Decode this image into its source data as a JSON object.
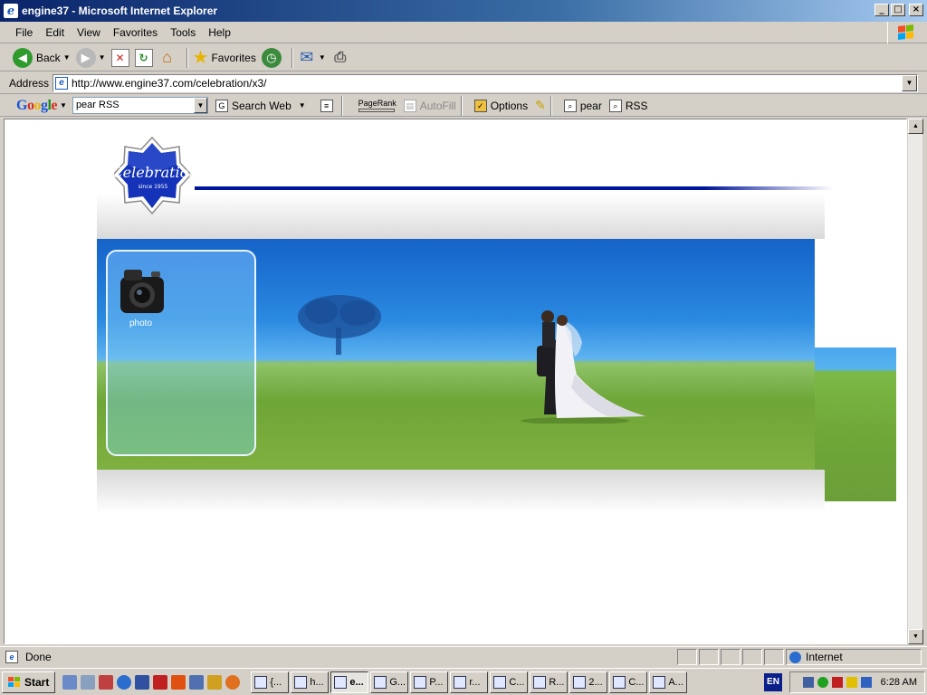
{
  "window": {
    "title": "engine37 - Microsoft Internet Explorer"
  },
  "menu": [
    "File",
    "Edit",
    "View",
    "Favorites",
    "Tools",
    "Help"
  ],
  "toolbar": {
    "back_label": "Back",
    "favorites_label": "Favorites"
  },
  "address": {
    "label": "Address",
    "url": "http://www.engine37.com/celebration/x3/"
  },
  "google_toolbar": {
    "search_value": "pear RSS",
    "search_web_label": "Search Web",
    "pagerank_label": "PageRank",
    "autofill_label": "AutoFill",
    "options_label": "Options",
    "highlight_terms": [
      "pear",
      "RSS"
    ]
  },
  "page": {
    "logo_text": "Celebration",
    "logo_since": "since 1955",
    "photo_label": "photo"
  },
  "status": {
    "text": "Done",
    "zone": "Internet"
  },
  "taskbar": {
    "start_label": "Start",
    "tasks": [
      "{...",
      "h...",
      "e...",
      "G...",
      "P...",
      "r...",
      "C...",
      "R...",
      "2...",
      "C...",
      "A..."
    ],
    "language": "EN",
    "clock": "6:28 AM"
  },
  "colors": {
    "title_bar": "#0a246a",
    "logo_blue": "#1433b8",
    "accent_line": "#00169a"
  }
}
